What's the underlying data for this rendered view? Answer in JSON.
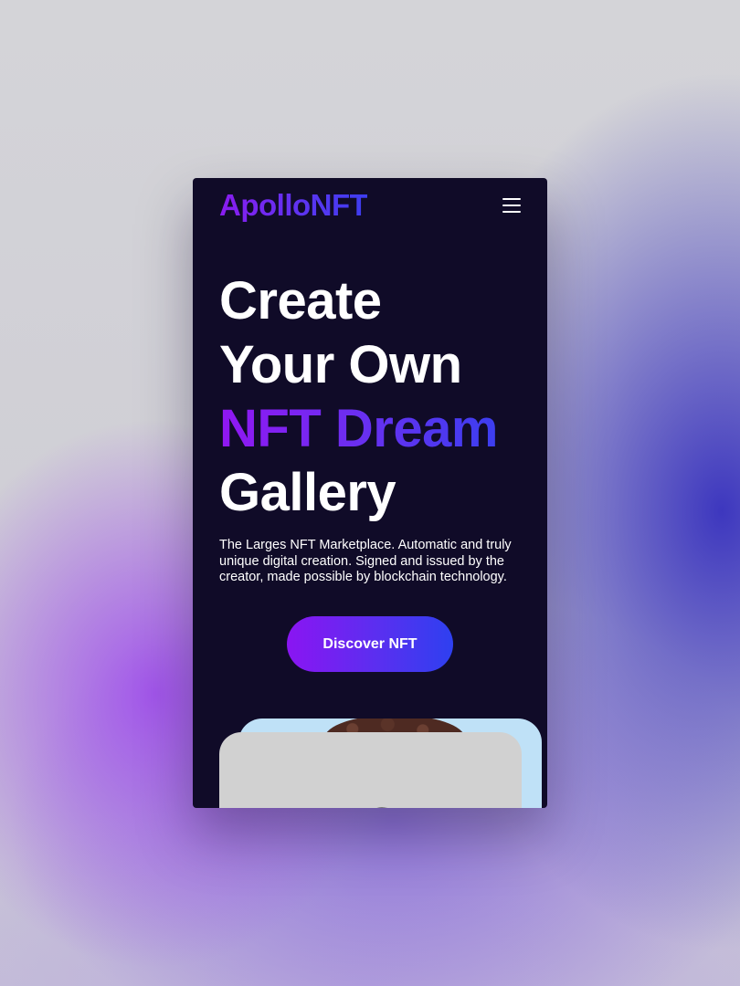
{
  "brand": {
    "name": "ApolloNFT",
    "menu_icon": "hamburger-menu-icon"
  },
  "hero": {
    "title_lines": [
      "Create",
      "Your Own",
      "NFT Dream",
      "Gallery"
    ],
    "highlight_line": "NFT Dream",
    "description": "The Larges NFT Marketplace. Automatic and truly unique digital creation. Signed and issued by the creator, made possible by blockchain technology.",
    "cta_label": "Discover NFT"
  },
  "colors": {
    "page_bg": "#100b28",
    "accent_purple": "#8a15f2",
    "accent_blue": "#2e40f0",
    "text": "#ffffff",
    "card_back": "#bfe1f7",
    "card_front": "#d1d1d1"
  }
}
